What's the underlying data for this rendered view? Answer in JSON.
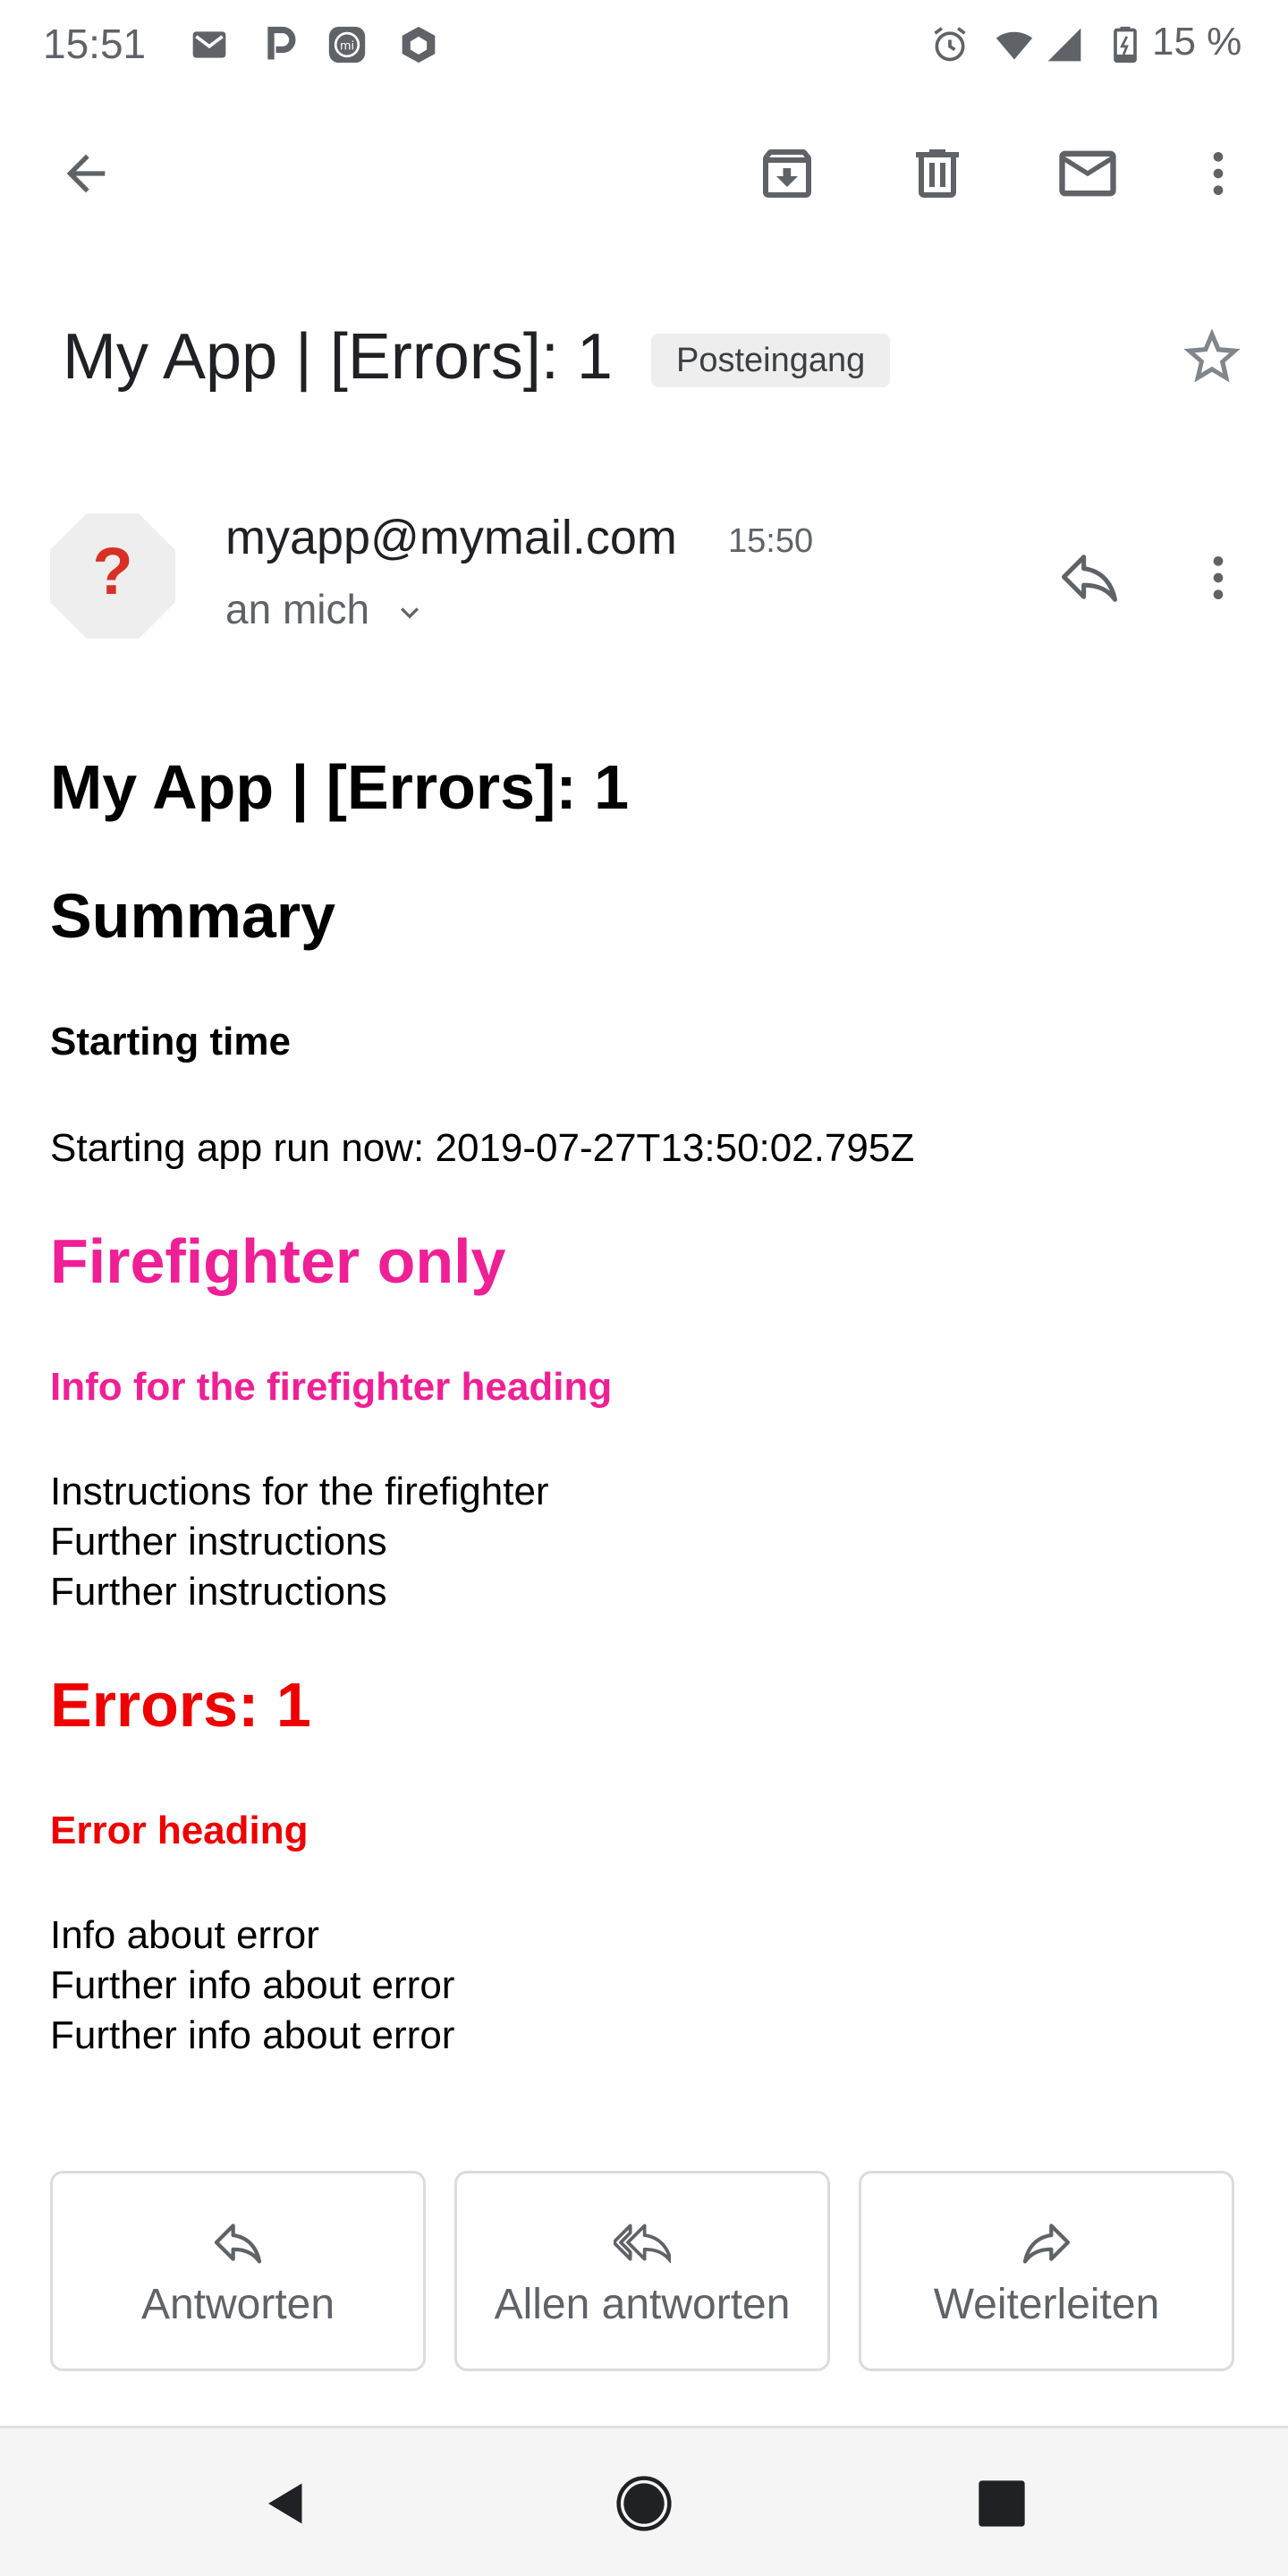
{
  "status_bar": {
    "time": "15:51",
    "battery_text": "15 %",
    "left_icons": [
      "gmail-icon",
      "p-icon",
      "mi-icon",
      "box-icon"
    ],
    "right_icons": [
      "alarm-icon",
      "wifi-icon",
      "signal-icon",
      "battery-icon"
    ]
  },
  "toolbar": {
    "icons": [
      "back-arrow-icon",
      "archive-icon",
      "delete-icon",
      "mark-unread-icon",
      "more-vert-icon"
    ]
  },
  "subject": {
    "title": "My App | [Errors]: 1",
    "label": "Posteingang"
  },
  "sender": {
    "email": "myapp@mymail.com",
    "time": "15:50",
    "recipient": "an mich",
    "avatar_glyph": "?"
  },
  "body": {
    "title": "My App | [Errors]: 1",
    "summary_heading": "Summary",
    "starting_time_heading": "Starting time",
    "starting_time_text": "Starting app run now: 2019-07-27T13:50:02.795Z",
    "firefighter_heading": "Firefighter only",
    "firefighter_subheading": "Info for the firefighter heading",
    "firefighter_lines": [
      "Instructions for the firefighter",
      "Further instructions",
      "Further instructions"
    ],
    "errors_heading": "Errors: 1",
    "error_subheading": "Error heading",
    "error_lines": [
      "Info about error",
      "Further info about error",
      "Further info about error"
    ]
  },
  "actions": {
    "reply": "Antworten",
    "reply_all": "Allen antworten",
    "forward": "Weiterleiten"
  },
  "colors": {
    "firefighter": "#ef1f96",
    "errors": "#ee0000",
    "avatar_bg": "#eeeeee",
    "avatar_fg": "#d93025"
  }
}
